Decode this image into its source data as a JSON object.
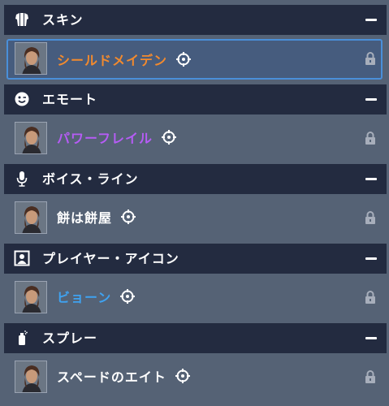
{
  "colors": {
    "page_bg": "#556275",
    "header_bg": "#232b40",
    "selected_bg": "#465c7e",
    "selected_border": "#4a8fd9",
    "rarity_legendary": "#f28a2e",
    "rarity_epic": "#b65cf5",
    "rarity_rare": "#3fa2f0",
    "rarity_common": "#ffffff",
    "lock": "#a7aebb"
  },
  "categories": [
    {
      "label": "スキン",
      "icon": "skin-icon",
      "item": {
        "name": "シールドメイデン",
        "rarity": "legendary",
        "selected": true,
        "event_icon": "crosshair-event-icon",
        "locked": true
      }
    },
    {
      "label": "エモート",
      "icon": "emote-icon",
      "item": {
        "name": "パワーフレイル",
        "rarity": "epic",
        "selected": false,
        "event_icon": "crosshair-event-icon",
        "locked": true
      }
    },
    {
      "label": "ボイス・ライン",
      "icon": "microphone-icon",
      "item": {
        "name": "餅は餅屋",
        "rarity": "common",
        "selected": false,
        "event_icon": "crosshair-event-icon",
        "locked": true
      }
    },
    {
      "label": "プレイヤー・アイコン",
      "icon": "player-icon-icon",
      "item": {
        "name": "ビョーン",
        "rarity": "rare",
        "selected": false,
        "event_icon": "crosshair-event-icon",
        "locked": true
      }
    },
    {
      "label": "スプレー",
      "icon": "spray-can-icon",
      "item": {
        "name": "スペードのエイト",
        "rarity": "common",
        "selected": false,
        "event_icon": "crosshair-event-icon",
        "locked": true
      }
    }
  ]
}
